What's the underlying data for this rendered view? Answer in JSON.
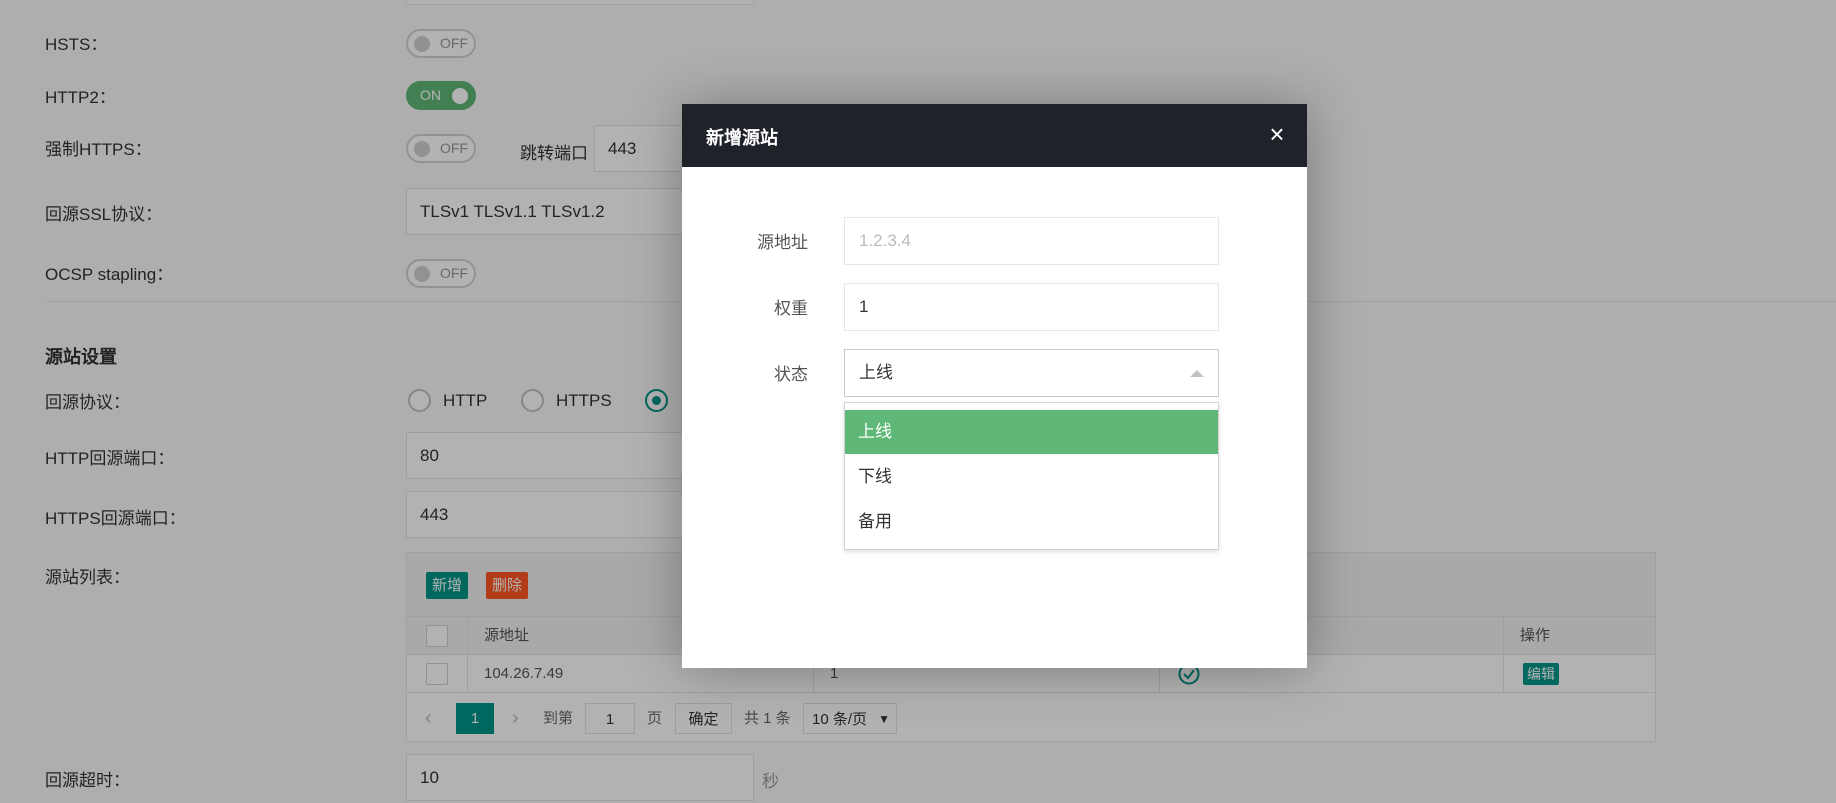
{
  "form": {
    "hsts_label": "HSTS：",
    "hsts_toggle": "OFF",
    "http2_label": "HTTP2：",
    "http2_toggle": "ON",
    "force_https_label": "强制HTTPS：",
    "force_https_toggle": "OFF",
    "redirect_port_label": "跳转端口",
    "redirect_port_value": "443",
    "ssl_protocol_label": "回源SSL协议：",
    "ssl_protocol_value": "TLSv1 TLSv1.1 TLSv1.2",
    "ocsp_label": "OCSP stapling：",
    "ocsp_toggle": "OFF"
  },
  "origin_section": {
    "title": "源站设置",
    "protocol_label": "回源协议：",
    "protocol_options": [
      "HTTP",
      "HTTPS"
    ],
    "http_port_label": "HTTP回源端口：",
    "http_port_value": "80",
    "https_port_label": "HTTPS回源端口：",
    "https_port_value": "443",
    "list_label": "源站列表：",
    "add_button": "新增",
    "delete_button": "删除",
    "table": {
      "headers": [
        "源地址",
        "操作"
      ],
      "rows": [
        {
          "address": "104.26.7.49",
          "weight": "1",
          "edit_label": "编辑"
        }
      ]
    },
    "pager": {
      "current_page": "1",
      "goto_label": "到第",
      "goto_value": "1",
      "page_suffix": "页",
      "confirm_button": "确定",
      "total_text": "共 1 条",
      "page_size": "10 条/页"
    },
    "timeout_label": "回源超时：",
    "timeout_value": "10",
    "timeout_unit": "秒"
  },
  "modal": {
    "title": "新增源站",
    "close_icon": "×",
    "address_label": "源地址",
    "address_placeholder": "1.2.3.4",
    "weight_label": "权重",
    "weight_value": "1",
    "status_label": "状态",
    "status_selected": "上线",
    "status_options": [
      "上线",
      "下线",
      "备用"
    ]
  },
  "colors": {
    "accent_green": "#5fb878",
    "teal": "#009688",
    "danger": "#ff5722",
    "modal_header": "#20222a"
  }
}
